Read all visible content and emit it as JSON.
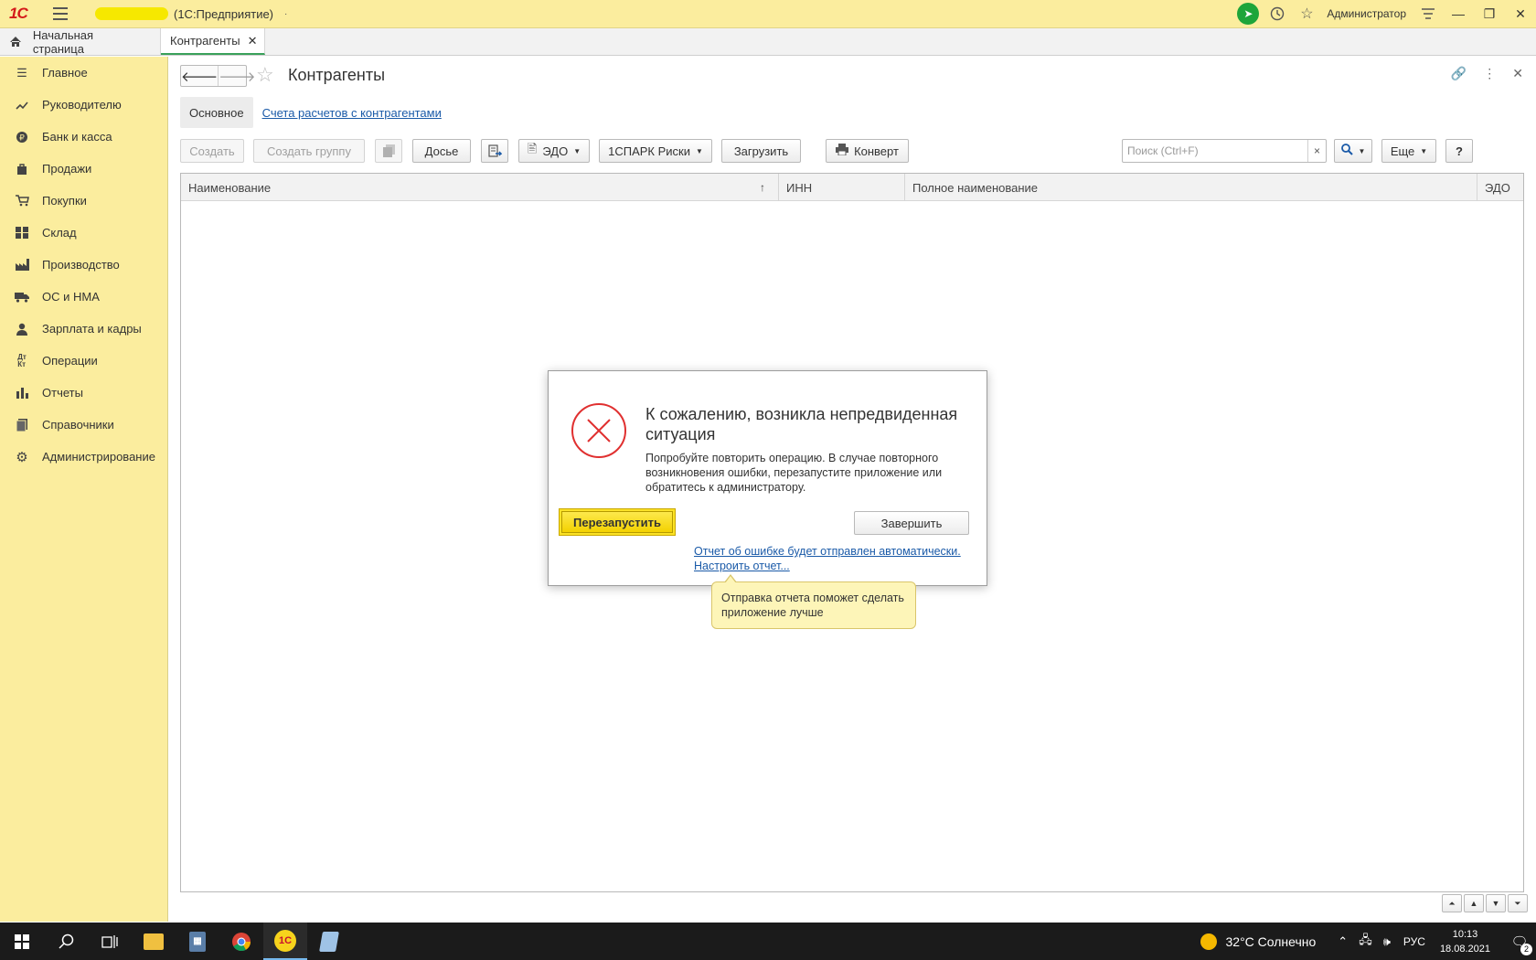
{
  "titlebar": {
    "logo_text": "1С",
    "app_title": "(1С:Предприятие)",
    "title_dot": "·",
    "user": "Администратор",
    "icons": [
      "telegram-icon",
      "history-icon",
      "star-icon",
      "settings-lines-icon"
    ],
    "window_controls": [
      "minimize",
      "restore",
      "close"
    ]
  },
  "tabs": {
    "home_label": "Начальная страница",
    "active_tab_label": "Контрагенты"
  },
  "sidebar": {
    "items": [
      {
        "label": "Главное",
        "icon": "menu-lines-icon"
      },
      {
        "label": "Руководителю",
        "icon": "trend-icon"
      },
      {
        "label": "Банк и касса",
        "icon": "coin-icon"
      },
      {
        "label": "Продажи",
        "icon": "bag-icon"
      },
      {
        "label": "Покупки",
        "icon": "cart-icon"
      },
      {
        "label": "Склад",
        "icon": "grid-icon"
      },
      {
        "label": "Производство",
        "icon": "factory-icon"
      },
      {
        "label": "ОС и НМА",
        "icon": "truck-icon"
      },
      {
        "label": "Зарплата и кадры",
        "icon": "person-icon"
      },
      {
        "label": "Операции",
        "icon": "debit-credit-icon"
      },
      {
        "label": "Отчеты",
        "icon": "bar-chart-icon"
      },
      {
        "label": "Справочники",
        "icon": "books-icon"
      },
      {
        "label": "Администрирование",
        "icon": "gear-icon"
      }
    ]
  },
  "form": {
    "title": "Контрагенты",
    "subtab_active": "Основное",
    "subtab_link": "Счета расчетов с контрагентами"
  },
  "toolbar": {
    "create": "Создать",
    "create_group": "Создать группу",
    "dossier": "Досье",
    "edo": "ЭДО",
    "spark": "1СПАРК Риски",
    "load": "Загрузить",
    "envelope": "Конверт",
    "search_placeholder": "Поиск (Ctrl+F)",
    "search_clear": "×",
    "more": "Еще",
    "help": "?"
  },
  "grid": {
    "columns": [
      "Наименование",
      "ИНН",
      "Полное наименование",
      "ЭДО"
    ],
    "sort_indicator": "↑",
    "rows": []
  },
  "dialog": {
    "title": "К сожалению, возникла непредвиденная ситуация",
    "text": "Попробуйте повторить операцию. В случае повторного возникновения ошибки, перезапустите приложение или обратитесь к администратору.",
    "restart_button": "Перезапустить",
    "finish_button": "Завершить",
    "report_link": "Отчет об ошибке будет отправлен автоматически.",
    "configure_link": "Настроить отчет..."
  },
  "tooltip": {
    "text": "Отправка отчета поможет сделать приложение лучше"
  },
  "taskbar": {
    "weather": "32°C  Солнечно",
    "lang": "РУС",
    "time": "10:13",
    "date": "18.08.2021",
    "notifications": "2",
    "apps": [
      "start",
      "search",
      "task-view",
      "explorer",
      "calculator",
      "chrome",
      "1c",
      "notepad"
    ]
  }
}
